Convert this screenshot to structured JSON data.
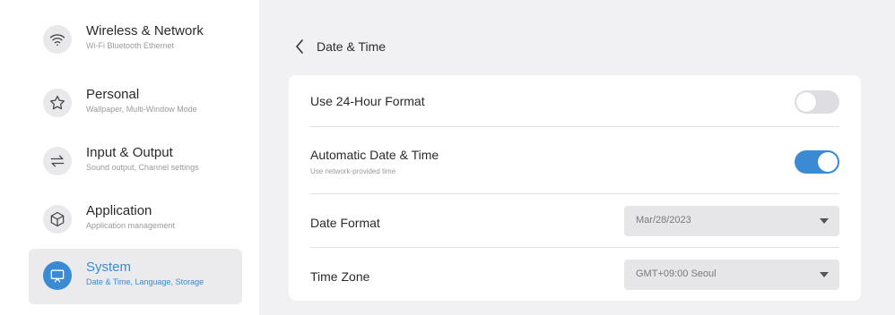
{
  "sidebar": {
    "items": [
      {
        "title": "Wireless & Network",
        "subtitle": "Wi-Fi Bluetooth Ethernet",
        "icon": "wifi-icon"
      },
      {
        "title": "Personal",
        "subtitle": "Wallpaper, Multi-Window Mode",
        "icon": "star-icon"
      },
      {
        "title": "Input & Output",
        "subtitle": "Sound output, Channel settings",
        "icon": "swap-arrows-icon"
      },
      {
        "title": "Application",
        "subtitle": "Application management",
        "icon": "cube-icon"
      },
      {
        "title": "System",
        "subtitle": "Date & Time, Language, Storage",
        "icon": "monitor-icon"
      }
    ],
    "active_index": 4
  },
  "header": {
    "back_icon": "chevron-left-icon",
    "title": "Date & Time"
  },
  "settings": {
    "hour24": {
      "label": "Use 24-Hour Format",
      "enabled": false
    },
    "auto_time": {
      "label": "Automatic Date & Time",
      "subtitle": "Use network-provided time",
      "enabled": true
    },
    "date_format": {
      "label": "Date Format",
      "value": "Mar/28/2023"
    },
    "time_zone": {
      "label": "Time Zone",
      "value": "GMT+09:00 Seoul"
    }
  },
  "colors": {
    "accent": "#3a8ad4",
    "background": "#f1f1f4",
    "card": "#ffffff"
  }
}
